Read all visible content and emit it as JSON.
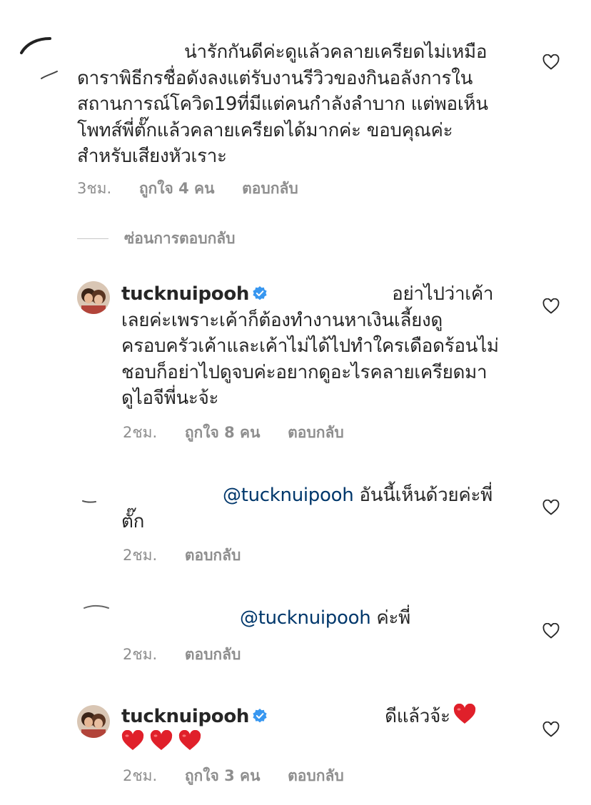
{
  "comments": [
    {
      "username": "",
      "mention": "",
      "text": "น่ารักกันดีค่ะดูแล้วคลายเครียดไม่เหมือ\nดาราพิธีกรชื่อดังลงแต่รับงานรีวิวของกินอลังการใน\nสถานการณ์โควิด19ที่มีแต่คนกำลังลำบาก แต่พอเห็น\nโพทส์พี่ตั๊กแล้วคลายเครียดได้มากค่ะ ขอบคุณค่ะ\nสำหรับเสียงหัวเราะ",
      "time": "3ชม.",
      "likes": "ถูกใจ 4 คน",
      "reply": "ตอบกลับ"
    },
    {
      "username": "tucknuipooh",
      "mention": "",
      "text": "อย่าไปว่าเค้า\nเลยค่ะเพราะเค้าก็ต้องทำงานหาเงินเลี้ยงดู\nครอบครัวเค้าและเค้าไม่ได้ไปทำใครเดือดร้อนไม่\nชอบก็อย่าไปดูจบค่ะอยากดูอะไรคลายเครียดมา\nดูไอจีพี่นะจ้ะ",
      "time": "2ชม.",
      "likes": "ถูกใจ 8 คน",
      "reply": "ตอบกลับ"
    },
    {
      "username": "",
      "mention": "@tucknuipooh",
      "text": "อันนี้เห็นด้วยค่ะพี่\nตั๊ก",
      "time": "2ชม.",
      "likes": "",
      "reply": "ตอบกลับ"
    },
    {
      "username": "",
      "mention": "@tucknuipooh",
      "text": "ค่ะพี่",
      "time": "2ชม.",
      "likes": "",
      "reply": "ตอบกลับ"
    },
    {
      "username": "tucknuipooh",
      "mention": "",
      "text": "ดีแล้วจ้ะ",
      "time": "2ชม.",
      "likes": "ถูกใจ 3 คน",
      "reply": "ตอบกลับ"
    }
  ],
  "hide_replies_label": "ซ่อนการตอบกลับ",
  "colors": {
    "text": "#262626",
    "meta": "#8e8e8e",
    "mention": "#00376b",
    "verified": "#3897f0",
    "heart_emoji": "#e0202a"
  },
  "icons": {
    "like": "heart-outline-icon",
    "verified": "verified-badge-icon",
    "emoji": "red-heart-emoji"
  }
}
